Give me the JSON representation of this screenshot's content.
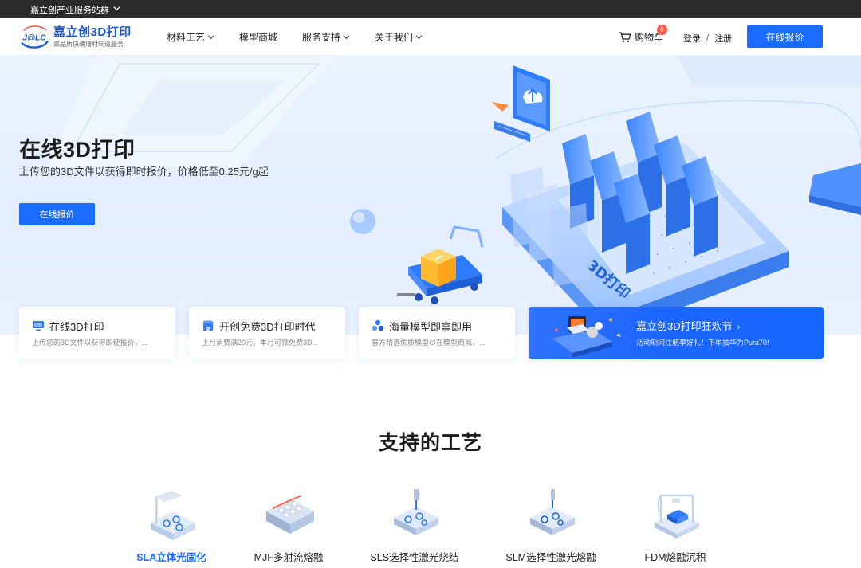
{
  "topbar": {
    "text": "嘉立创产业服务站群"
  },
  "header": {
    "logo_badge": "J@LC",
    "logo_name": "嘉立创3D打印",
    "logo_tagline": "高品质快速增材制造服务",
    "nav": [
      {
        "label": "材料工艺",
        "has_caret": true
      },
      {
        "label": "模型商城",
        "has_caret": false
      },
      {
        "label": "服务支持",
        "has_caret": true
      },
      {
        "label": "关于我们",
        "has_caret": true
      }
    ],
    "cart_label": "购物车",
    "cart_count": "0",
    "login_label": "登录",
    "login_sep": "/",
    "register_label": "注册",
    "quote_button": "在线报价"
  },
  "hero": {
    "title": "在线3D打印",
    "subtitle": "上传您的3D文件以获得即时报价，价格低至0.25元/g起",
    "button": "在线报价",
    "illustration_label": "3D打印"
  },
  "cards": [
    {
      "title": "在线3D打印",
      "desc": "上传您的3D文件以获得即使报价，...",
      "icon": "monitor-icon",
      "color": "#2f7bff"
    },
    {
      "title": "开创免费3D打印时代",
      "desc": "上月消费满20元，本月可领免费3D...",
      "icon": "shop-icon",
      "color": "#2f7bff"
    },
    {
      "title": "海量模型即拿即用",
      "desc": "官方精选优质模型尽在模型商城，...",
      "icon": "cluster-icon",
      "color": "#2f7bff"
    }
  ],
  "promo": {
    "title": "嘉立创3D打印狂欢节",
    "arrow": "›",
    "desc": "活动期间注册享好礼！下单抽华为Pura70!"
  },
  "section": {
    "title": "支持的工艺",
    "processes": [
      {
        "label": "SLA立体光固化",
        "active": true,
        "icon": "sla-printer-icon"
      },
      {
        "label": "MJF多射流熔融",
        "active": false,
        "icon": "mjf-printer-icon"
      },
      {
        "label": "SLS选择性激光烧结",
        "active": false,
        "icon": "sls-printer-icon"
      },
      {
        "label": "SLM选择性激光熔融",
        "active": false,
        "icon": "slm-printer-icon"
      },
      {
        "label": "FDM熔融沉积",
        "active": false,
        "icon": "fdm-printer-icon"
      }
    ]
  },
  "colors": {
    "accent": "#1a6bff",
    "topbar": "#2b2b2b",
    "hero_bg": "#e4efff",
    "badge": "#ff5a4e"
  }
}
